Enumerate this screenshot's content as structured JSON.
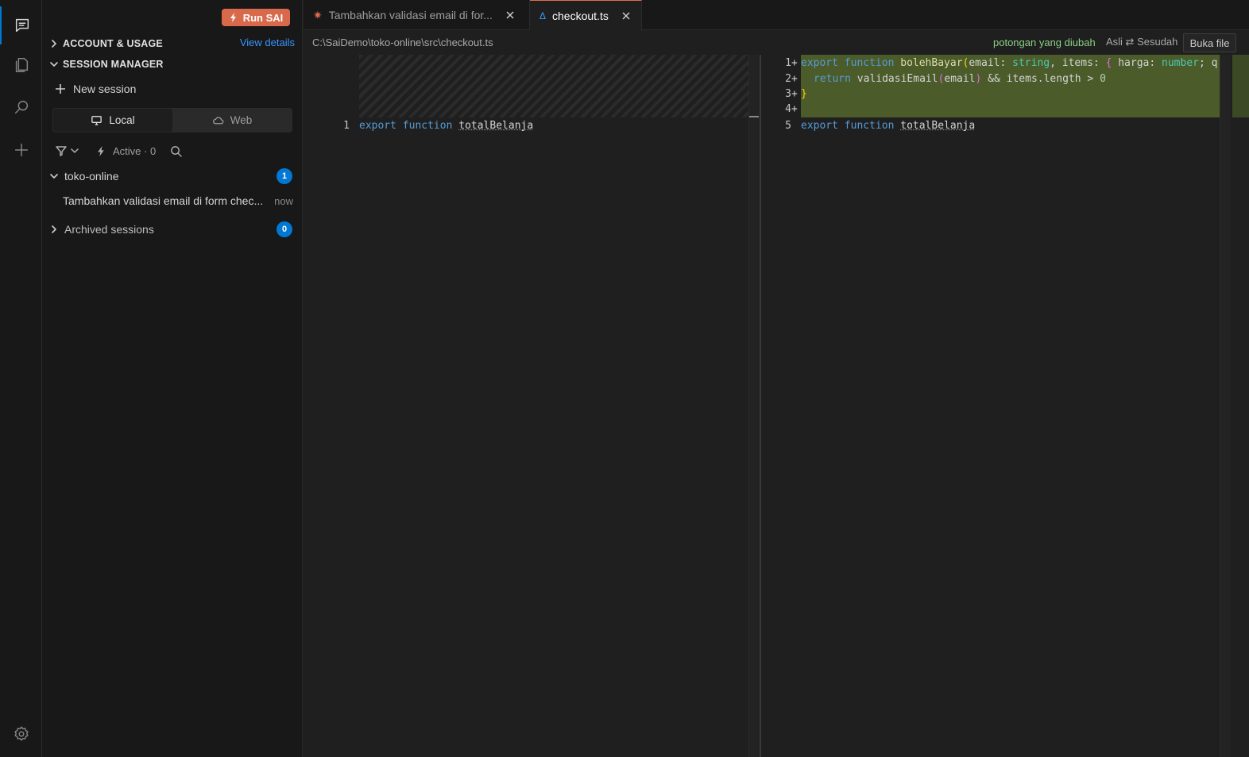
{
  "sidebar": {
    "run_button": "Run SAI",
    "account_section": "ACCOUNT & USAGE",
    "view_details": "View details",
    "session_manager": "SESSION MANAGER",
    "new_session": "New session",
    "seg_local": "Local",
    "seg_web": "Web",
    "active_filter": "Active · 0",
    "repo_name": "toko-online",
    "repo_count": "1",
    "session_title": "Tambahkan validasi email di form chec...",
    "session_time": "now",
    "archived": "Archived sessions",
    "archived_count": "0"
  },
  "tabs": [
    {
      "label": "Tambahkan validasi email di for...",
      "icon": "sparkle-icon"
    },
    {
      "label": "checkout.ts",
      "icon": "diff-icon"
    }
  ],
  "crumb": {
    "path": "C:\\SaiDemo\\toko-online\\src\\checkout.ts",
    "changed": "potongan yang diubah",
    "toggle": "Asli ⇄ Sesudah",
    "open_file": "Buka file"
  },
  "left_editor": {
    "line_no": "1",
    "kw1": "export",
    "kw2": "function",
    "name": "totalBelanja"
  },
  "right_editor": {
    "l1": "1",
    "l2": "2",
    "l3": "3",
    "l4": "4",
    "l5": "5",
    "plus": "+",
    "kw_export": "export",
    "kw_function": "function",
    "fn_name": "bolehBayar",
    "p_open": "(",
    "param1": "email: ",
    "type_string": "string",
    "sep1": ", items: ",
    "brace_open": "{",
    "param2": " harga: ",
    "type_number": "number",
    "tail": "; q",
    "kw_return": "return",
    "call": "validasiEmail",
    "call_open": "(",
    "call_arg": "email",
    "call_close": ")",
    "rest": " && items.length > ",
    "zero": "0",
    "brace_close": "}",
    "name5": "totalBelanja"
  },
  "colors": {
    "accent": "#0078d4",
    "run_button": "#d9694b",
    "added_bg": "#4b5b2a",
    "changed_text": "#89d185"
  }
}
